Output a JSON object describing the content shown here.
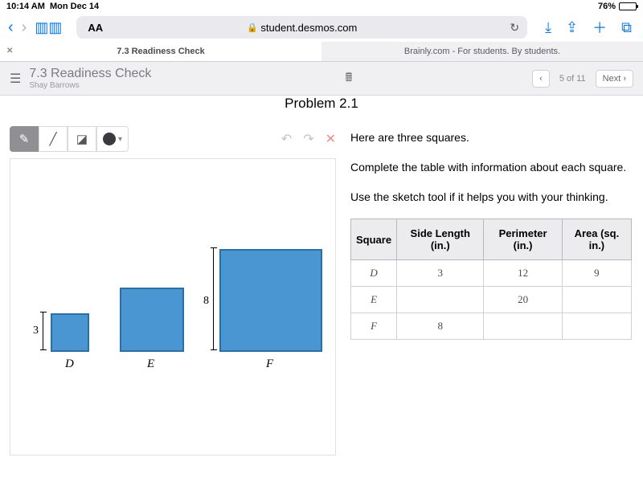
{
  "status": {
    "time": "10:14 AM",
    "date": "Mon Dec 14",
    "battery": "76%"
  },
  "safari": {
    "url": "student.desmos.com"
  },
  "tabs": [
    {
      "label": "7.3 Readiness Check",
      "active": true
    },
    {
      "label": "Brainly.com - For students. By students.",
      "active": false
    }
  ],
  "activity": {
    "title": "7.3 Readiness Check",
    "student": "Shay Barrows"
  },
  "pager": {
    "pos": "5 of 11",
    "next": "Next"
  },
  "problem": {
    "title": "Problem 2.1",
    "line1": "Here are three squares.",
    "line2": "Complete the table with information about each square.",
    "line3": "Use the sketch tool if it helps you with your thinking."
  },
  "sketch": {
    "squares": [
      {
        "name": "D",
        "dim": "3"
      },
      {
        "name": "E",
        "dim": ""
      },
      {
        "name": "F",
        "dim": "8"
      }
    ]
  },
  "table": {
    "headers": [
      "Square",
      "Side Length (in.)",
      "Perimeter (in.)",
      "Area  (sq. in.)"
    ],
    "rows": [
      {
        "name": "D",
        "side": "3",
        "perim": "12",
        "area": "9"
      },
      {
        "name": "E",
        "side": "",
        "perim": "20",
        "area": ""
      },
      {
        "name": "F",
        "side": "8",
        "perim": "",
        "area": ""
      }
    ]
  },
  "chart_data": {
    "type": "table",
    "columns": [
      "Square",
      "Side Length (in.)",
      "Perimeter (in.)",
      "Area (sq. in.)"
    ],
    "rows": [
      [
        "D",
        3,
        12,
        9
      ],
      [
        "E",
        null,
        20,
        null
      ],
      [
        "F",
        8,
        null,
        null
      ]
    ]
  }
}
